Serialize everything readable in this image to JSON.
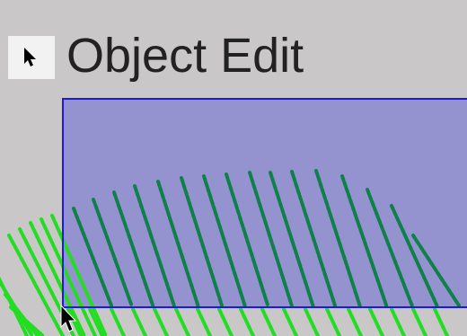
{
  "header": {
    "mode_icon": "arrow-cursor-icon",
    "title": "Object Edit"
  },
  "colors": {
    "background": "#c9c7c8",
    "selection_fill": "#9593cf",
    "selection_border": "#1a1ae0",
    "geometry_dark": "#10804a",
    "geometry_light": "#22dd22",
    "cursor": "#000000"
  },
  "selection": {
    "tool": "box-select"
  },
  "mouse_cursor": "arrow-cursor-icon"
}
